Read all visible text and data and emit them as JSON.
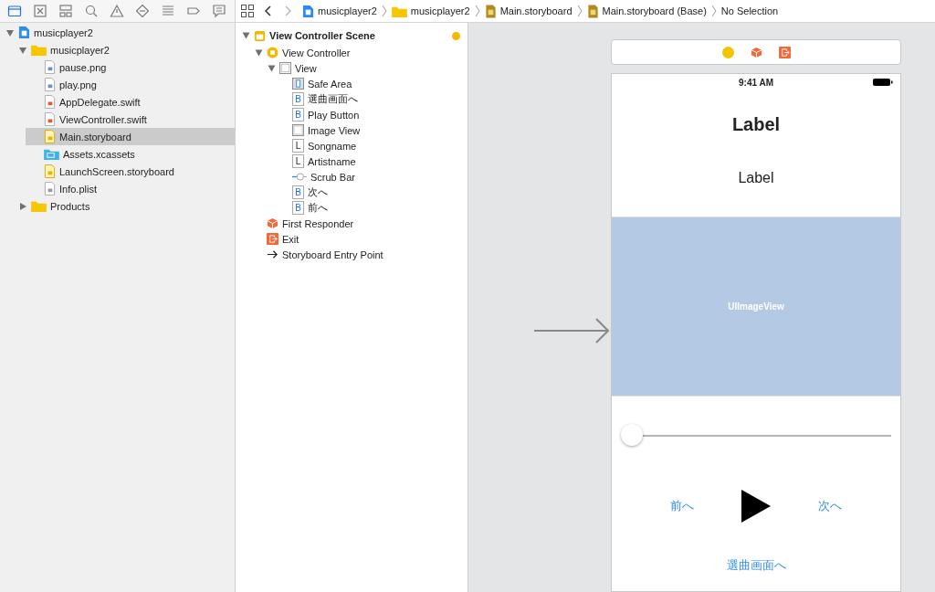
{
  "navigator": {
    "tabs": [
      {
        "kind": "folder",
        "selected": true
      },
      {
        "kind": "source",
        "selected": false
      },
      {
        "kind": "hierarchy",
        "selected": false
      },
      {
        "kind": "search",
        "selected": false
      },
      {
        "kind": "warning",
        "selected": false
      },
      {
        "kind": "test",
        "selected": false
      },
      {
        "kind": "debug",
        "selected": false
      },
      {
        "kind": "breakpoint",
        "selected": false
      },
      {
        "kind": "report",
        "selected": false
      }
    ],
    "tree": [
      {
        "label": "musicplayer2",
        "kind": "project",
        "expanded": true,
        "selected": false,
        "children": [
          {
            "label": "musicplayer2",
            "kind": "folder",
            "expanded": true,
            "selected": false,
            "children": [
              {
                "label": "pause.png",
                "kind": "image",
                "selected": false
              },
              {
                "label": "play.png",
                "kind": "image",
                "selected": false
              },
              {
                "label": "AppDelegate.swift",
                "kind": "swift",
                "selected": false
              },
              {
                "label": "ViewController.swift",
                "kind": "swift",
                "selected": false
              },
              {
                "label": "Main.storyboard",
                "kind": "storyboard",
                "selected": true
              },
              {
                "label": "Assets.xcassets",
                "kind": "assets",
                "selected": false
              },
              {
                "label": "LaunchScreen.storyboard",
                "kind": "storyboard",
                "selected": false
              },
              {
                "label": "Info.plist",
                "kind": "plist",
                "selected": false
              }
            ]
          },
          {
            "label": "Products",
            "kind": "folder",
            "expanded": false,
            "selected": false
          }
        ]
      }
    ]
  },
  "jump_bar": [
    {
      "kind": "project",
      "label": "musicplayer2"
    },
    {
      "kind": "folder",
      "label": "musicplayer2"
    },
    {
      "kind": "storyboard",
      "label": "Main.storyboard"
    },
    {
      "kind": "storyboard",
      "label": "Main.storyboard (Base)"
    },
    {
      "kind": "none",
      "label": "No Selection"
    }
  ],
  "outline": [
    {
      "label": "View Controller Scene",
      "kind": "scene",
      "expanded": true,
      "children": [
        {
          "label": "View Controller",
          "kind": "controller",
          "expanded": true,
          "children": [
            {
              "label": "View",
              "kind": "view",
              "expanded": true,
              "children": [
                {
                  "label": "Safe Area",
                  "kind": "safe-area"
                },
                {
                  "label": "選曲画面へ",
                  "kind": "button",
                  "letter": "B"
                },
                {
                  "label": "Play Button",
                  "kind": "button",
                  "letter": "B"
                },
                {
                  "label": "Image View",
                  "kind": "image"
                },
                {
                  "label": "Songname",
                  "kind": "label",
                  "letter": "L"
                },
                {
                  "label": "Artistname",
                  "kind": "label",
                  "letter": "L"
                },
                {
                  "label": "Scrub Bar",
                  "kind": "slider"
                },
                {
                  "label": "次へ",
                  "kind": "button",
                  "letter": "B"
                },
                {
                  "label": "前へ",
                  "kind": "button",
                  "letter": "B"
                }
              ]
            }
          ]
        },
        {
          "label": "First Responder",
          "kind": "responder"
        },
        {
          "label": "Exit",
          "kind": "exit"
        },
        {
          "label": "Storyboard Entry Point",
          "kind": "arrow"
        }
      ]
    }
  ],
  "device": {
    "time": "9:41 AM",
    "song_label": "Label",
    "artist_label": "Label",
    "image_view": "UIImageView",
    "scrub": {
      "level": 0
    },
    "prev_button": "前へ",
    "next_button": "次へ",
    "select_button": "選曲画面へ"
  }
}
